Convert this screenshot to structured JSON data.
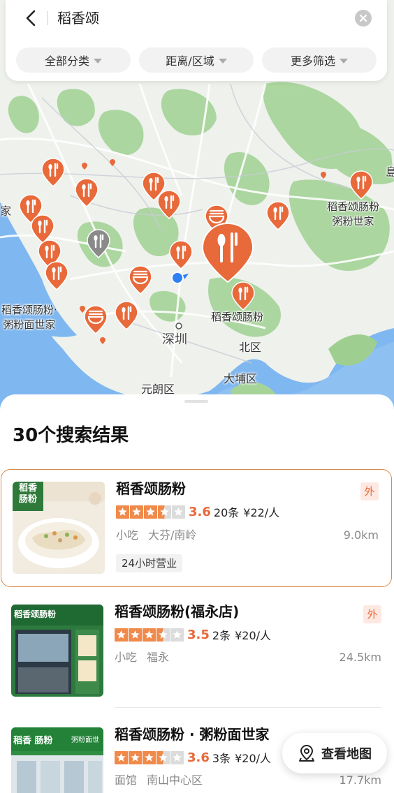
{
  "search": {
    "query": "稻香颂"
  },
  "filters": [
    {
      "label": "全部分类"
    },
    {
      "label": "距离/区域"
    },
    {
      "label": "更多筛选"
    }
  ],
  "map": {
    "labels": {
      "shenzhen": "深圳",
      "beiqu": "北区",
      "dapeng": "大埔区",
      "yuanlang": "元朗区",
      "left_edge": "家",
      "right_edge": "島"
    },
    "shop_labels": {
      "right_top_line1": "稻香颂肠粉",
      "right_top_line2": "粥粉世家",
      "left_line1": "稻香颂肠粉·",
      "left_line2": "粥粉面世家",
      "center": "稻香颂肠粉"
    },
    "colors": {
      "pin": "#e8693a",
      "pin_gray": "#8a8a8a",
      "location": "#2f7ff5",
      "water": "#7fb7f0",
      "land": "#eef2ee",
      "green": "#9fcf90"
    }
  },
  "results": {
    "title": "30个搜索结果",
    "items": [
      {
        "name": "稻香颂肠粉",
        "score": "3.6",
        "stars": 3.5,
        "reviews": "20条",
        "price": "¥22/人",
        "category": "小吃",
        "area": "大芬/南岭",
        "distance": "9.0km",
        "tag": "24小时营业",
        "takeout": "外",
        "thumb_text_top": "稻香",
        "thumb_text_bottom": "肠粉"
      },
      {
        "name": "稻香颂肠粉(福永店)",
        "score": "3.5",
        "stars": 3.5,
        "reviews": "2条",
        "price": "¥20/人",
        "category": "小吃",
        "area": "福永",
        "distance": "24.5km",
        "takeout": "外",
        "thumb_text": "稻香颂肠粉"
      },
      {
        "name": "稻香颂肠粉 · 粥粉面世家",
        "score": "3.6",
        "stars": 3.5,
        "reviews": "3条",
        "price": "¥20/人",
        "category": "面馆",
        "area": "南山中心区",
        "distance": "17.7km",
        "thumb_text": "稻香 肠粉",
        "thumb_text_right": "粥粉面世"
      }
    ]
  },
  "view_map": {
    "label": "查看地图"
  }
}
